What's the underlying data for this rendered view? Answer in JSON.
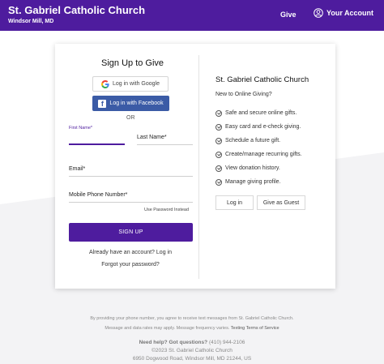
{
  "header": {
    "church_name": "St. Gabriel Catholic Church",
    "location": "Windsor Mill, MD",
    "give_label": "Give",
    "account_label": "Your Account",
    "color": "#4e1c9e"
  },
  "signup": {
    "title": "Sign Up to Give",
    "google_label": "Log in with Google",
    "facebook_label": "Log in with Facebook",
    "or_label": "OR",
    "first_name_label": "First Name*",
    "last_name_label": "Last Name*",
    "email_label": "Email*",
    "phone_label": "Mobile Phone Number*",
    "use_password_label": "Use Password Instead",
    "signup_button": "SIGN UP",
    "have_account_text": "Already have an account?",
    "login_link": "Log in",
    "forgot_password": "Forgot your password?"
  },
  "info": {
    "title": "St. Gabriel Catholic Church",
    "subtitle": "New to Online Giving?",
    "features": [
      "Safe and secure online gifts.",
      "Easy card and e-check giving.",
      "Schedule a future gift.",
      "Create/manage recurring gifts.",
      "View donation history.",
      "Manage giving profile."
    ],
    "login_button": "Log in",
    "guest_button": "Give as Guest"
  },
  "footer": {
    "consent_text": "By providing your phone number, you agree to receive text messages from St. Gabriel Catholic Church.",
    "rates_text": "Message and data rates may apply. Message frequency varies.",
    "terms_link": "Texting Terms of Service",
    "help_label": "Need help? Got questions?",
    "help_phone": "(410) 944-2106",
    "copyright_prefix": "©2023",
    "copyright_name": "St. Gabriel Catholic Church",
    "address": "6950 Dogwood Road, Windsor Mill, MD  21244, US"
  }
}
